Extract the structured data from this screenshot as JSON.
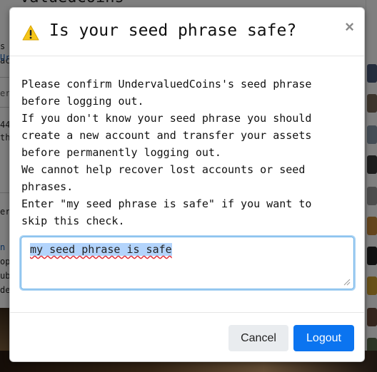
{
  "background": {
    "title": "valuedCoins",
    "fragments": [
      "s",
      "ac",
      "Ur",
      "er",
      "44",
      "th",
      "er",
      "n J",
      "op",
      "ub",
      "de"
    ]
  },
  "modal": {
    "icon": "warning-icon",
    "title": "Is your seed phrase safe?",
    "close_label": "×",
    "message_lines": [
      "Please confirm UndervaluedCoins's seed phrase",
      "before logging out.",
      "If you don't know your seed phrase you should",
      "create a new account and transfer your assets",
      "before permanently logging out.",
      "We cannot help recover lost accounts or seed",
      "phrases.",
      "Enter \"my seed phrase is safe\" if you want to",
      "skip this check."
    ],
    "confirm_input": {
      "value": "my seed phrase is safe"
    },
    "buttons": {
      "cancel": "Cancel",
      "logout": "Logout"
    }
  },
  "colors": {
    "primary": "#0b74f0",
    "warning": "#f5c518",
    "focus_ring": "#66afe9"
  }
}
